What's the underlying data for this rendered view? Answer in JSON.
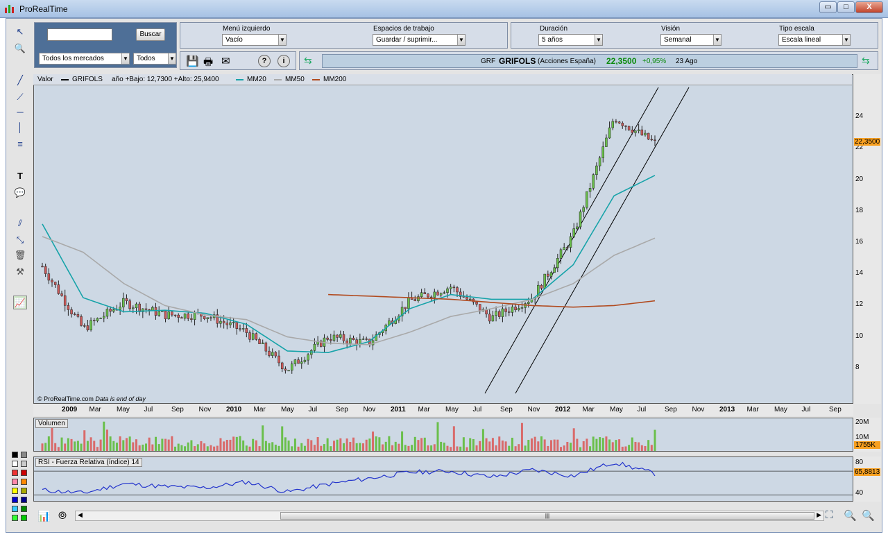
{
  "window": {
    "title": "ProRealTime",
    "min": "▭",
    "max": "□",
    "close": "X"
  },
  "search": {
    "value": "",
    "button": "Buscar",
    "market": "Todos los mercados",
    "filter": "Todos"
  },
  "menu": {
    "left_label": "Menú izquierdo",
    "left_value": "Vacío",
    "workspace_label": "Espacios de trabajo",
    "workspace_value": "Guardar / suprimir...",
    "duration_label": "Duración",
    "duration_value": "5 años",
    "view_label": "Visión",
    "view_value": "Semanal",
    "scale_label": "Tipo escala",
    "scale_value": "Escala lineal"
  },
  "quote": {
    "code": "GRF",
    "name": "GRIFOLS",
    "desc": "(Acciones España)",
    "price": "22,3500",
    "change": "+0,95%",
    "date": "23 Ago"
  },
  "legend": {
    "valor": "Valor",
    "symbol": "GRIFOLS",
    "range": "año +Bajo: 12,7300 +Alto: 25,9400",
    "mm20": "MM20",
    "mm50": "MM50",
    "mm200": "MM200"
  },
  "colors": {
    "mm20": "#17a3a9",
    "mm50": "#a9a9a9",
    "mm200": "#b14a1e",
    "up": "#6abf4b",
    "down": "#cc5a5a"
  },
  "credit": {
    "text": "© ProRealTime.com",
    "note": "Data is end of day"
  },
  "price_axis": {
    "ticks": [
      "24",
      "22",
      "20",
      "18",
      "16",
      "14",
      "12",
      "10",
      "8"
    ],
    "last": "22,3500"
  },
  "time_axis": [
    {
      "t": "2009",
      "b": true
    },
    {
      "t": "Mar"
    },
    {
      "t": "May"
    },
    {
      "t": "Jul"
    },
    {
      "t": "Sep"
    },
    {
      "t": "Nov"
    },
    {
      "t": "2010",
      "b": true
    },
    {
      "t": "Mar"
    },
    {
      "t": "May"
    },
    {
      "t": "Jul"
    },
    {
      "t": "Sep"
    },
    {
      "t": "Nov"
    },
    {
      "t": "2011",
      "b": true
    },
    {
      "t": "Mar"
    },
    {
      "t": "May"
    },
    {
      "t": "Jul"
    },
    {
      "t": "Sep"
    },
    {
      "t": "Nov"
    },
    {
      "t": "2012",
      "b": true
    },
    {
      "t": "Mar"
    },
    {
      "t": "May"
    },
    {
      "t": "Jul"
    },
    {
      "t": "Sep"
    },
    {
      "t": "Nov"
    },
    {
      "t": "2013",
      "b": true
    },
    {
      "t": "Mar"
    },
    {
      "t": "May"
    },
    {
      "t": "Jul"
    },
    {
      "t": "Sep"
    }
  ],
  "volume": {
    "title": "Volumen",
    "ticks": [
      "20M",
      "10M"
    ],
    "last": "1755K"
  },
  "rsi": {
    "title": "RSI - Fuerza Relativa (índice) 14",
    "ticks": [
      "80",
      "40"
    ],
    "last": "65,8813"
  },
  "chart_data": [
    {
      "type": "line",
      "title": "GRIFOLS",
      "x": [
        "2009-01",
        "2009-04",
        "2009-07",
        "2009-10",
        "2010-01",
        "2010-04",
        "2010-07",
        "2010-10",
        "2011-01",
        "2011-04",
        "2011-07",
        "2011-10",
        "2012-01",
        "2012-04",
        "2012-07",
        "2012-08"
      ],
      "series": [
        {
          "name": "GRIFOLS",
          "values": [
            14.5,
            10.5,
            12.2,
            11.4,
            11.4,
            10.3,
            7.9,
            10.0,
            9.6,
            12.3,
            13.2,
            11.2,
            12.5,
            16.5,
            24.0,
            22.35
          ]
        },
        {
          "name": "MM20",
          "values": [
            17.2,
            12.5,
            11.6,
            11.7,
            11.5,
            10.8,
            9.1,
            9.0,
            9.7,
            11.8,
            12.7,
            12.4,
            12.4,
            14.6,
            19.0,
            20.3
          ]
        },
        {
          "name": "MM50",
          "values": [
            16.4,
            15.4,
            13.4,
            12.0,
            11.4,
            11.1,
            10.0,
            9.6,
            9.5,
            10.3,
            11.3,
            11.8,
            12.4,
            13.4,
            15.2,
            16.3
          ]
        },
        {
          "name": "MM200",
          "values": [
            null,
            null,
            null,
            null,
            null,
            null,
            null,
            12.7,
            12.6,
            12.5,
            12.4,
            12.2,
            12.0,
            11.9,
            12.0,
            12.3
          ]
        }
      ],
      "ylim": [
        6,
        26
      ]
    },
    {
      "type": "bar",
      "title": "Volumen",
      "ylim": [
        0,
        25
      ],
      "ylabel": "M"
    },
    {
      "type": "line",
      "title": "RSI - Fuerza Relativa (índice) 14",
      "ylim": [
        20,
        90
      ],
      "values": [
        38,
        33,
        49,
        44,
        42,
        52,
        35,
        48,
        58,
        68,
        70,
        60,
        72,
        62,
        85,
        65.88
      ]
    }
  ]
}
